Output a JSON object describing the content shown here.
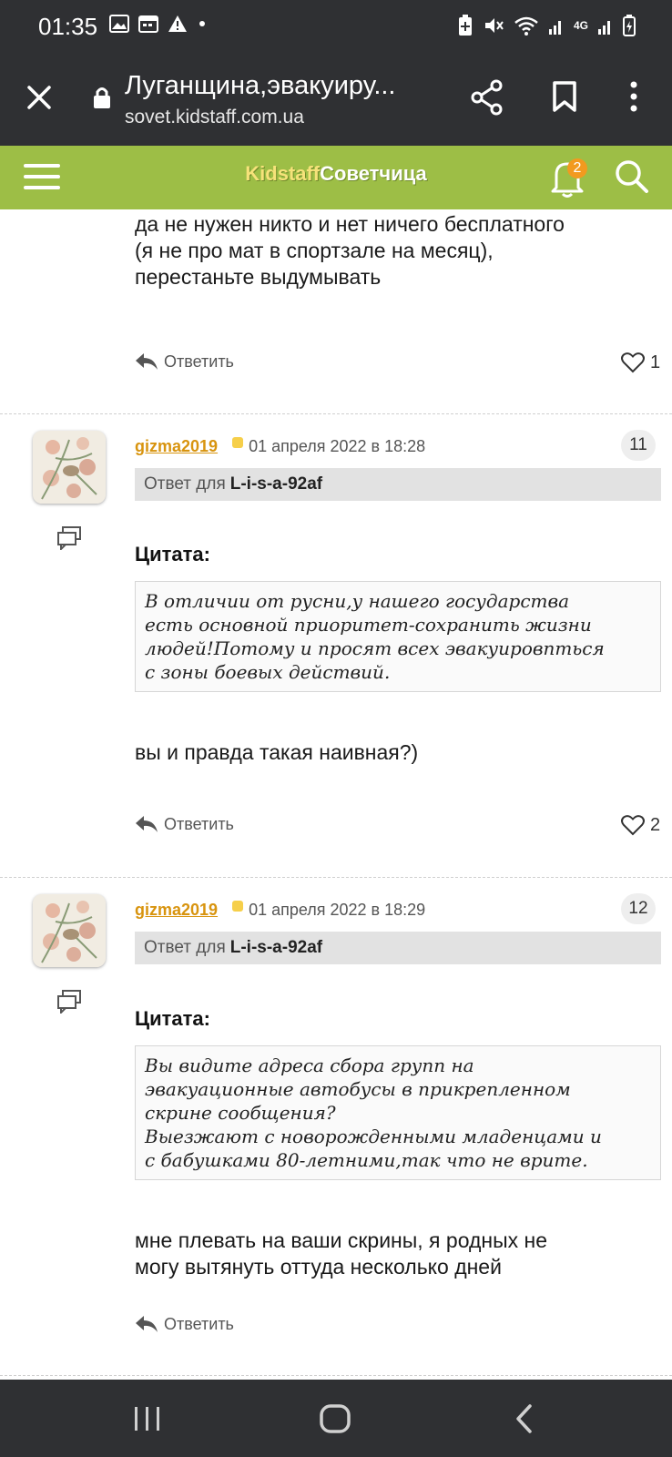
{
  "status": {
    "time": "01:35",
    "network": "4G"
  },
  "browser": {
    "tab_title": "Луганщина,эвакуиру...",
    "domain": "sovet.kidstaff.com.ua"
  },
  "site": {
    "logo_part1": "Kidstaff",
    "logo_part2": "Советчица",
    "notif_count": "2",
    "accent": "#9dbe46"
  },
  "posts": [
    {
      "text_lines": [
        "да не нужен никто и нет ничего бесплатного",
        "(я не про мат в спортзале на месяц),",
        "перестаньте выдумывать"
      ],
      "reply_label": "Ответить",
      "likes": "1"
    },
    {
      "username": "gizma2019",
      "date": "01 апреля 2022 в 18:28",
      "number": "11",
      "reply_to_label": "Ответ для",
      "reply_to_user": "L-i-s-a-92af",
      "quote_label": "Цитата:",
      "quote_lines": [
        "В отличии от русни,у нашего государства",
        "есть основной приоритет-сохранить жизни",
        "людей!Потому и просят всех эвакуировпться",
        "с зоны боевых действий."
      ],
      "text_lines": [
        "вы и правда такая наивная?)"
      ],
      "reply_label": "Ответить",
      "likes": "2"
    },
    {
      "username": "gizma2019",
      "date": "01 апреля 2022 в 18:29",
      "number": "12",
      "reply_to_label": "Ответ для",
      "reply_to_user": "L-i-s-a-92af",
      "quote_label": "Цитата:",
      "quote_lines": [
        "Вы видите адреса сбора групп на",
        "эвакуационные автобусы в прикрепленном",
        "скрине сообщения?",
        "Выезжают с новорожденными младенцами и",
        "с бабушками 80-летними,так что не врите."
      ],
      "text_lines": [
        "мне плевать на ваши скрины, я родных не",
        "могу вытянуть оттуда несколько дней"
      ],
      "reply_label": "Ответить"
    }
  ]
}
